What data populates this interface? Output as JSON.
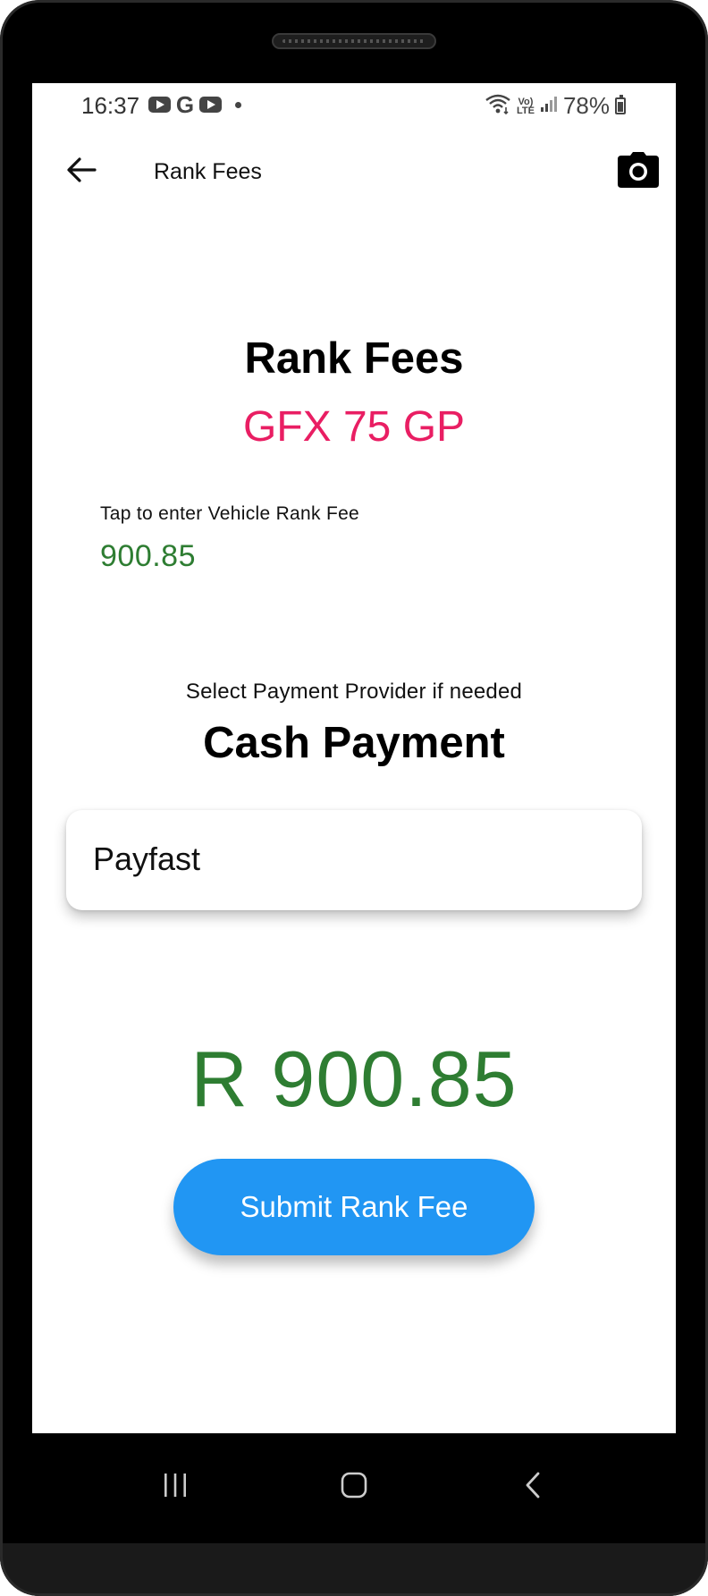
{
  "status_bar": {
    "time": "16:37",
    "battery_percent": "78%",
    "notification_icons": [
      "youtube-icon",
      "google-icon",
      "youtube-icon",
      "dot-icon"
    ],
    "system_icons": [
      "wifi-icon",
      "volte-lte-icon",
      "signal-icon",
      "battery-icon"
    ],
    "volte_top": "Vo)",
    "volte_bottom": "LTE"
  },
  "app_bar": {
    "title": "Rank Fees",
    "back_icon": "arrow-left-icon",
    "action_icon": "camera-icon"
  },
  "main": {
    "heading": "Rank Fees",
    "vehicle_reg": "GFX 75 GP",
    "fee_field": {
      "label": "Tap to enter Vehicle Rank Fee",
      "value": "900.85"
    },
    "provider_prompt": "Select Payment Provider if needed",
    "payment_type": "Cash Payment",
    "provider_option": "Payfast",
    "total_display": "R 900.85",
    "submit_label": "Submit Rank Fee"
  },
  "nav_bar": {
    "recents_icon": "recent-apps-icon",
    "home_icon": "home-icon",
    "back_icon": "back-chevron-icon"
  },
  "colors": {
    "accent_pink": "#e91e63",
    "amount_green": "#2e7d32",
    "button_blue": "#2196f3"
  }
}
